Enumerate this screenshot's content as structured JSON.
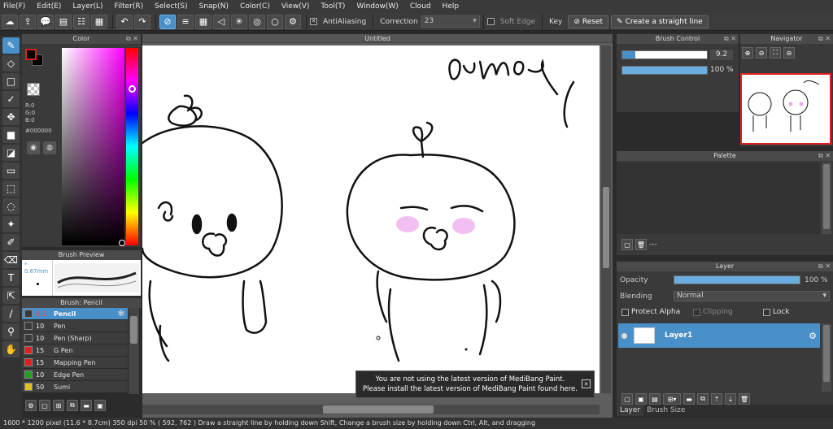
{
  "menu": {
    "file": "File(F)",
    "edit": "Edit(E)",
    "layer": "Layer(L)",
    "filter": "Filter(R)",
    "select": "Select(S)",
    "snap": "Snap(N)",
    "color": "Color(C)",
    "view": "View(V)",
    "tool": "Tool(T)",
    "window": "Window(W)",
    "cloud": "Cloud",
    "help": "Help"
  },
  "toolbar": {
    "antialiasing": "AntiAliasing",
    "correction_label": "Correction",
    "correction_value": "23",
    "soft_edge": "Soft Edge",
    "key_label": "Key",
    "reset": "Reset",
    "straight_line": "Create a straight line"
  },
  "color_panel": {
    "title": "Color",
    "r": "R:0",
    "g": "G:0",
    "b": "B:0",
    "hex": "#000000",
    "fg_color": "#000000"
  },
  "brush_preview": {
    "title": "Brush Preview",
    "size": "0.67mm"
  },
  "brush_list": {
    "title": "Brush: Pencil",
    "items": [
      {
        "size": "9.2",
        "name": "Pencil",
        "color": "#3a3a3a",
        "selected": true
      },
      {
        "size": "10",
        "name": "Pen",
        "color": "#3a3a3a"
      },
      {
        "size": "10",
        "name": "Pen (Sharp)",
        "color": "#3a3a3a"
      },
      {
        "size": "15",
        "name": "G Pen",
        "color": "#e02020"
      },
      {
        "size": "15",
        "name": "Mapping Pen",
        "color": "#e02020"
      },
      {
        "size": "10",
        "name": "Edge Pen",
        "color": "#20a020"
      },
      {
        "size": "50",
        "name": "Sumi",
        "color": "#e0c020"
      }
    ]
  },
  "canvas": {
    "tab": "Untitled",
    "title_scribble": "dumoy"
  },
  "notification": {
    "line1": "You are not using the latest version of MediBang Paint.",
    "line2": "Please install the latest version of MediBang Paint found here.",
    "close": "✕"
  },
  "brush_control": {
    "title": "Brush Control",
    "size_value": "9.2",
    "opacity_value": "100 %"
  },
  "navigator": {
    "title": "Navigator"
  },
  "palette": {
    "title": "Palette",
    "dots": "---"
  },
  "layer_panel": {
    "title": "Layer",
    "opacity_label": "Opacity",
    "opacity_value": "100 %",
    "blending_label": "Blending",
    "blending_value": "Normal",
    "protect_alpha": "Protect Alpha",
    "clipping": "Clipping",
    "lock": "Lock",
    "layer_name": "Layer1"
  },
  "bottom_tabs": {
    "layer": "Layer",
    "brush_size": "Brush Size"
  },
  "status": {
    "text": "1600 * 1200 pixel   (11.6 * 8.7cm)  350 dpi   50 %   ( 592, 762 )   Draw a straight line by holding down Shift, Change a brush size by holding down Ctrl, Alt, and dragging"
  },
  "colors": {
    "accent": "#4a90c8",
    "bg": "#2b2b2b",
    "panel": "#3a3a3a"
  }
}
